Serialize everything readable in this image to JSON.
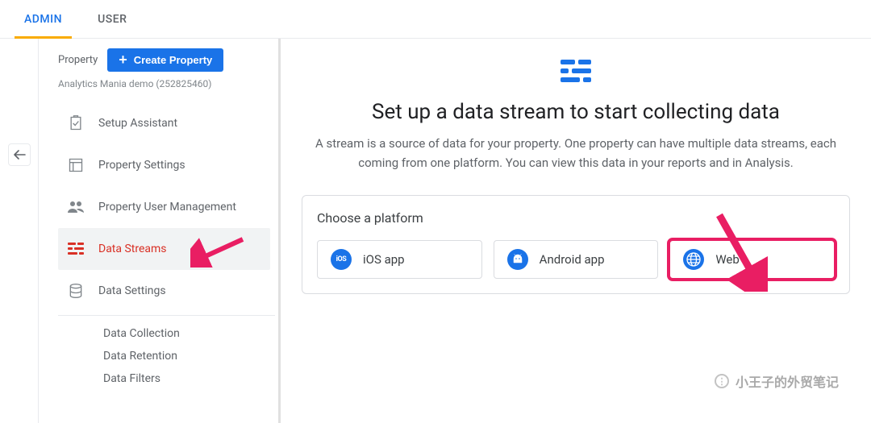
{
  "tabs": {
    "admin": "ADMIN",
    "user": "USER"
  },
  "sidebar": {
    "property_label": "Property",
    "create_btn": "Create Property",
    "property_name": "Analytics Mania demo (252825460)",
    "items": [
      {
        "label": "Setup Assistant"
      },
      {
        "label": "Property Settings"
      },
      {
        "label": "Property User Management"
      },
      {
        "label": "Data Streams"
      },
      {
        "label": "Data Settings"
      }
    ],
    "sub_items": [
      {
        "label": "Data Collection"
      },
      {
        "label": "Data Retention"
      },
      {
        "label": "Data Filters"
      }
    ]
  },
  "main": {
    "title": "Set up a data stream to start collecting data",
    "description": "A stream is a source of data for your property. One property can have multiple data streams, each coming from one platform. You can view this data in your reports and in Analysis.",
    "choose_platform": "Choose a platform",
    "platforms": {
      "ios": "iOS app",
      "android": "Android app",
      "web": "Web"
    }
  },
  "watermark": "小王子的外贸笔记"
}
